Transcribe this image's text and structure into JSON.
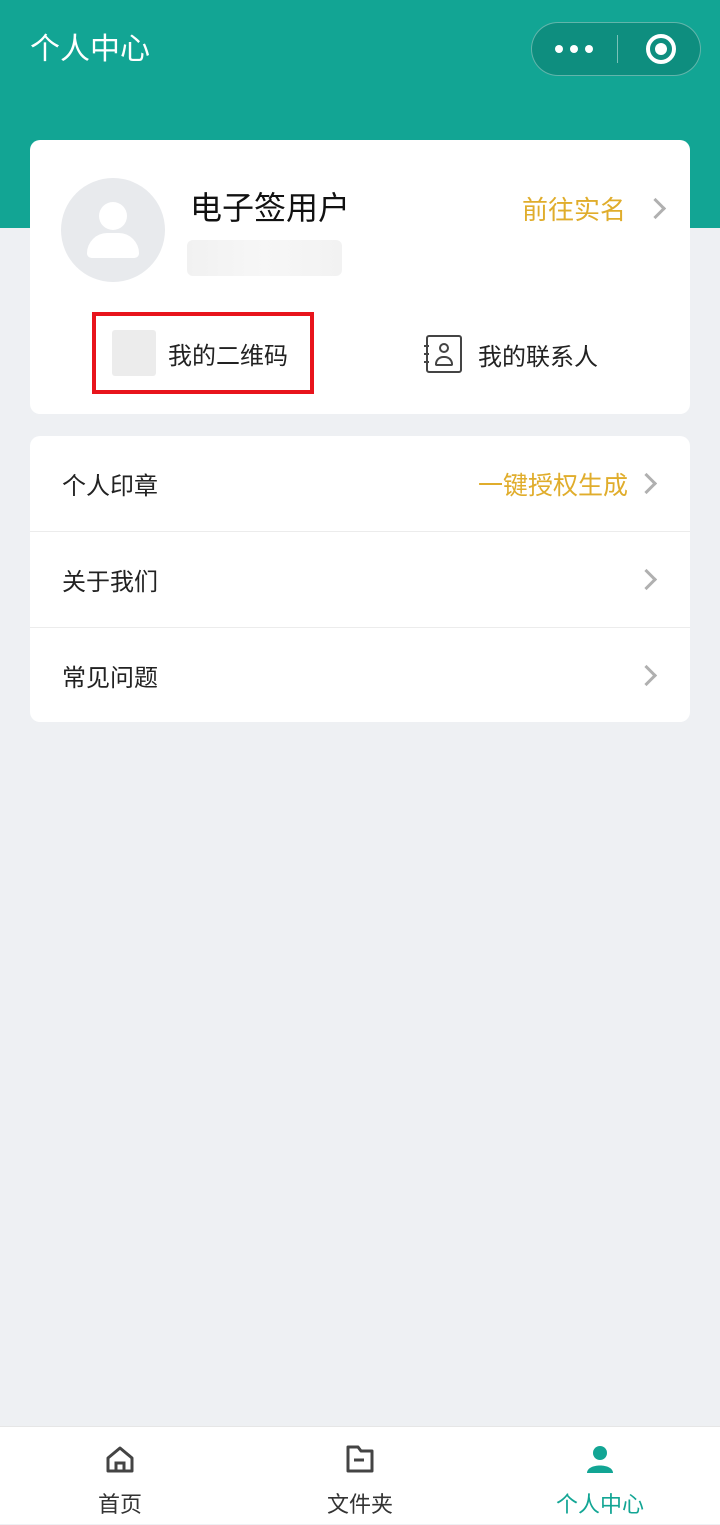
{
  "header": {
    "title": "个人中心",
    "accent_color": "#12a594",
    "capsule": {
      "more_icon": "more-dots-icon",
      "close_icon": "target-circle-icon"
    }
  },
  "profile": {
    "name": "电子签用户",
    "realname_link": "前往实名",
    "qrcode_label": "我的二维码",
    "contacts_label": "我的联系人"
  },
  "menu": {
    "items": [
      {
        "label": "个人印章",
        "value": "一键授权生成"
      },
      {
        "label": "关于我们",
        "value": ""
      },
      {
        "label": "常见问题",
        "value": ""
      }
    ]
  },
  "tabbar": {
    "items": [
      {
        "label": "首页",
        "icon": "home-icon",
        "active": false
      },
      {
        "label": "文件夹",
        "icon": "folder-icon",
        "active": false
      },
      {
        "label": "个人中心",
        "icon": "person-icon",
        "active": true
      }
    ]
  },
  "highlight_color": "#e8141c",
  "link_color": "#e0ad2c"
}
